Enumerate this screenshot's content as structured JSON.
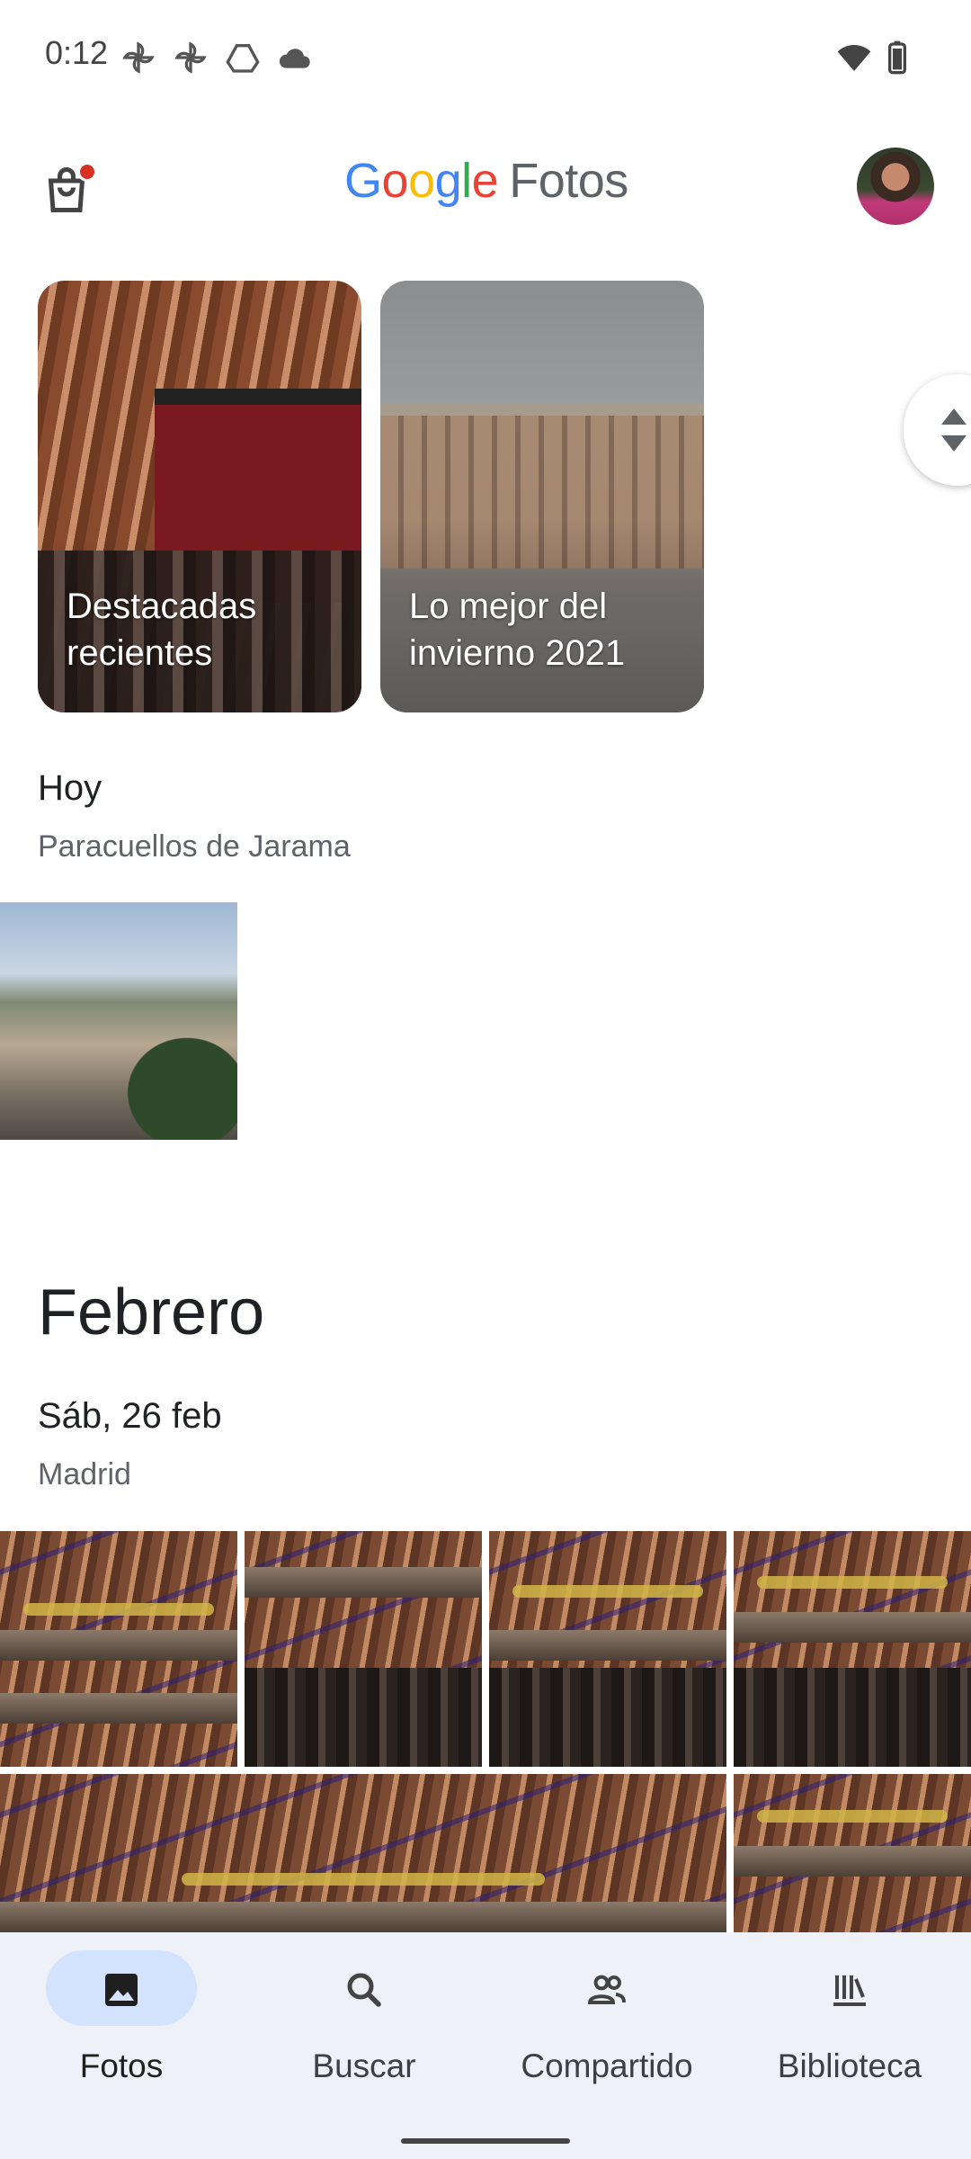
{
  "status_bar": {
    "time": "0:12",
    "icons": [
      "pinwheel-icon",
      "pinwheel-icon",
      "drive-icon",
      "cloud-icon",
      "wifi-icon",
      "battery-icon"
    ]
  },
  "header": {
    "brand_google": "Google",
    "brand_app": "Fotos",
    "has_notification_badge": true
  },
  "memories": [
    {
      "label_line1": "Destacadas",
      "label_line2": "recientes"
    },
    {
      "label_line1": "Lo mejor del",
      "label_line2": "invierno 2021"
    }
  ],
  "today": {
    "title": "Hoy",
    "location": "Paracuellos de Jarama"
  },
  "month": {
    "title": "Febrero",
    "day": "Sáb, 26 feb",
    "location": "Madrid"
  },
  "nav": {
    "items": [
      {
        "label": "Fotos",
        "icon": "photo-icon",
        "active": true
      },
      {
        "label": "Buscar",
        "icon": "search-icon",
        "active": false
      },
      {
        "label": "Compartido",
        "icon": "people-icon",
        "active": false
      },
      {
        "label": "Biblioteca",
        "icon": "library-icon",
        "active": false
      }
    ]
  },
  "colors": {
    "accent": "#1a73e8",
    "nav_background": "#eef2f8",
    "nav_active_pill": "#d3e3fd",
    "badge": "#d93025"
  }
}
